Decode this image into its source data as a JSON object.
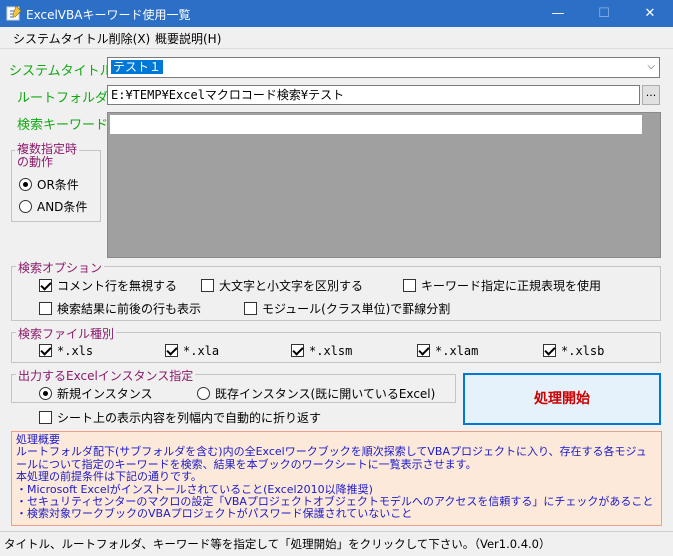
{
  "window": {
    "title": "ExcelVBAキーワード使用一覧",
    "minimize": "—",
    "maximize": "☐",
    "close": "✕"
  },
  "menu": {
    "items": [
      {
        "label": "システムタイトル削除(X)"
      },
      {
        "label": "概要説明(H)"
      }
    ]
  },
  "form": {
    "system_title_label": "システムタイトル",
    "system_title_value": "テスト１",
    "root_folder_label": "ルートフォルダ",
    "root_folder_value": "E:¥TEMP¥Excelマクロコード検索¥テスト",
    "browse_label": "...",
    "keyword_label": "検索キーワード",
    "keyword_value": ""
  },
  "multi_group": {
    "title": "複数指定時\nの動作",
    "options": [
      {
        "label": "OR条件",
        "checked": true
      },
      {
        "label": "AND条件",
        "checked": false
      }
    ]
  },
  "search_options": {
    "title": "検索オプション",
    "items": [
      {
        "label": "コメント行を無視する",
        "checked": true
      },
      {
        "label": "大文字と小文字を区別する",
        "checked": false
      },
      {
        "label": "キーワード指定に正規表現を使用",
        "checked": false
      },
      {
        "label": "検索結果に前後の行も表示",
        "checked": false
      },
      {
        "label": "モジュール(クラス単位)で罫線分割",
        "checked": false
      }
    ]
  },
  "file_types": {
    "title": "検索ファイル種別",
    "items": [
      {
        "label": "*.xls",
        "checked": true
      },
      {
        "label": "*.xla",
        "checked": true
      },
      {
        "label": "*.xlsm",
        "checked": true
      },
      {
        "label": "*.xlam",
        "checked": true
      },
      {
        "label": "*.xlsb",
        "checked": true
      }
    ]
  },
  "instance": {
    "title": "出力するExcelインスタンス指定",
    "options": [
      {
        "label": "新規インスタンス",
        "checked": true
      },
      {
        "label": "既存インスタンス(既に開いているExcel)",
        "checked": false
      }
    ],
    "wrap_label": "シート上の表示内容を列幅内で自動的に折り返す",
    "wrap_checked": false
  },
  "start_button": {
    "label": "処理開始",
    "color": "#cc0000"
  },
  "overview": {
    "title": "処理概要",
    "lines": [
      "ルートフォルダ配下(サブフォルダを含む)内の全Excelワークブックを順次探索してVBAプロジェクトに入り、存在する各モジュ",
      "ールについて指定のキーワードを検索、結果を本ブックのワークシートに一覧表示させます。",
      "本処理の前提条件は下記の通りです。",
      "・Microsoft Excelがインストールされていること(Excel2010以降推奨)",
      "・セキュリティセンターのマクロの設定「VBAプロジェクトオブジェクトモデルへのアクセスを信頼する」にチェックがあること",
      "・検索対象ワークブックのVBAプロジェクトがパスワード保護されていないこと"
    ],
    "bg": "#fde9d9",
    "text_color": "#1a1acc"
  },
  "status": {
    "text": "タイトル、ルートフォルダ、キーワード等を指定して「処理開始」をクリックして下さい。（Ver1.0.4.0）"
  }
}
